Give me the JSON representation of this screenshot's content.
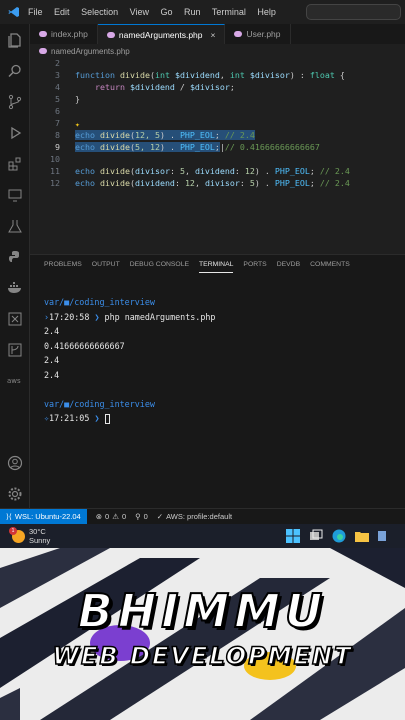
{
  "menu": [
    "File",
    "Edit",
    "Selection",
    "View",
    "Go",
    "Run",
    "Terminal",
    "Help"
  ],
  "tabs": [
    {
      "label": "index.php"
    },
    {
      "label": "namedArguments.php"
    },
    {
      "label": "User.php"
    }
  ],
  "breadcrumb": "namedArguments.php",
  "editor": {
    "line_numbers": [
      "2",
      "3",
      "4",
      "5",
      "6",
      "7",
      "8",
      "9",
      "10",
      "11",
      "12"
    ],
    "lines": {
      "l3": {
        "kw": "function",
        "fn": "divide",
        "p1t": "int",
        "p1": "$dividend",
        "p2t": "int",
        "p2": "$divisor",
        "rt": "float"
      },
      "l4": {
        "ret": "return",
        "a": "$dividend",
        "b": "$divisor"
      },
      "l8": {
        "echo": "echo",
        "fn": "divide",
        "args": "12, 5",
        "const": "PHP_EOL",
        "cm": "// 2.4"
      },
      "l9": {
        "echo": "echo",
        "fn": "divide",
        "args": "5, 12",
        "const": "PHP_EOL",
        "cm": "// 0.41666666666667"
      },
      "l11": {
        "echo": "echo",
        "fn": "divide",
        "n1": "divisor",
        "v1": "5",
        "n2": "dividend",
        "v2": "12",
        "const": "PHP_EOL",
        "cm": "// 2.4"
      },
      "l12": {
        "echo": "echo",
        "fn": "divide",
        "n1": "dividend",
        "v1": "12",
        "n2": "divisor",
        "v2": "5",
        "const": "PHP_EOL",
        "cm": "// 2.4"
      }
    }
  },
  "panel_tabs": [
    "PROBLEMS",
    "OUTPUT",
    "DEBUG CONSOLE",
    "TERMINAL",
    "PORTS",
    "DEVDB",
    "COMMENTS"
  ],
  "terminal": {
    "path1": "var/■/coding_interview",
    "time1": "17:20:58",
    "command": "php namedArguments.php",
    "output": [
      "2.4",
      "0.41666666666667",
      "2.4",
      "2.4"
    ],
    "path2": "var/■/coding_interview",
    "time2": "17:21:05"
  },
  "status": {
    "remote": "WSL: Ubuntu-22.04",
    "errors": "0",
    "warnings": "0",
    "ports": "0",
    "aws": "AWS: profile:default"
  },
  "weather": {
    "temp": "30°C",
    "cond": "Sunny",
    "badge": "1"
  },
  "brand": {
    "line1": "BHIMMU",
    "line2": "WEB DEVELOPMENT"
  },
  "colors": {
    "accent": "#0078d4",
    "keyword": "#569cd6",
    "function": "#dcdcaa",
    "variable": "#9cdcfe",
    "comment": "#6a9955"
  }
}
